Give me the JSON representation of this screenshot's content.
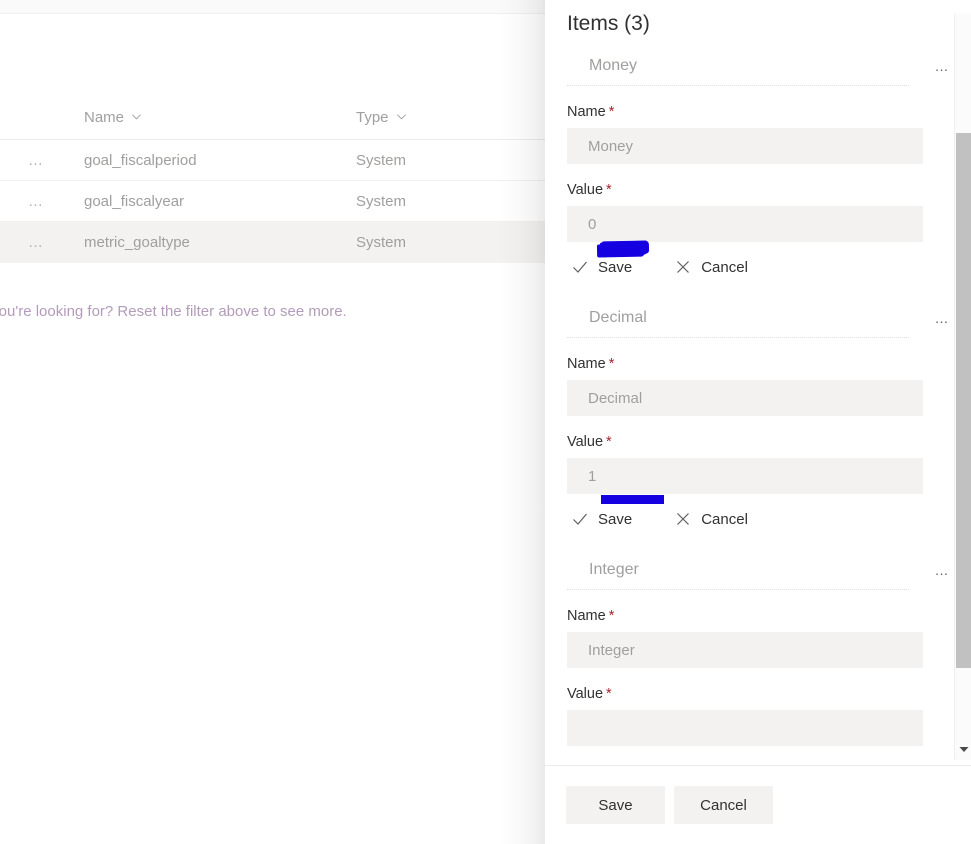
{
  "background_page": {
    "grid": {
      "columns": [
        {
          "label": "Name",
          "sort_icon": "chevron-down-icon"
        },
        {
          "label": "Type",
          "sort_icon": "chevron-down-icon"
        }
      ],
      "row_menu_glyph": "…",
      "rows": [
        {
          "name": "goal_fiscalperiod",
          "type": "System",
          "selected": false
        },
        {
          "name": "goal_fiscalyear",
          "type": "System",
          "selected": false
        },
        {
          "name": "metric_goaltype",
          "type": "System",
          "selected": true
        }
      ]
    },
    "empty_message": "… you're looking for? Reset the filter above to see more."
  },
  "panel": {
    "title": "Items (3)",
    "item_menu_glyph": "…",
    "labels": {
      "name": "Name",
      "value": "Value",
      "required_mark": "*",
      "save": "Save",
      "cancel": "Cancel"
    },
    "items": [
      {
        "header": "Money",
        "name_value": "Money",
        "value_value": "0",
        "has_marker": true,
        "marker_style": "rough"
      },
      {
        "header": "Decimal",
        "name_value": "Decimal",
        "value_value": "1",
        "has_marker": true,
        "marker_style": "straight"
      },
      {
        "header": "Integer",
        "name_value": "Integer",
        "value_value": "",
        "has_marker": false,
        "marker_style": ""
      }
    ],
    "footer": {
      "save": "Save",
      "cancel": "Cancel"
    }
  },
  "scrollbar": {
    "down_arrow_icon": "chevron-down-icon"
  },
  "colors": {
    "marker_blue": "#1400e0",
    "required_red": "#a4262c",
    "input_bg": "#f3f2f1",
    "muted_text": "#a19f9d",
    "primary_text": "#323130",
    "empty_message": "#b39bba"
  }
}
